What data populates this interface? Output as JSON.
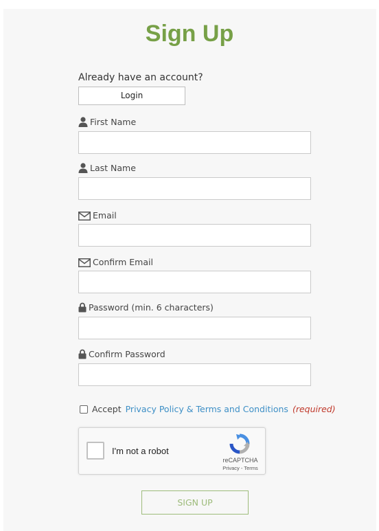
{
  "page": {
    "title": "Sign Up",
    "already_text": "Already have an account?",
    "login_label": "Login"
  },
  "fields": [
    {
      "label": "First Name",
      "icon": "user-icon",
      "value": ""
    },
    {
      "label": "Last Name",
      "icon": "user-icon",
      "value": ""
    },
    {
      "label": "Email",
      "icon": "envelope-icon",
      "value": ""
    },
    {
      "label": "Confirm Email",
      "icon": "envelope-icon",
      "value": ""
    },
    {
      "label": "Password (min. 6 characters)",
      "icon": "lock-icon",
      "value": ""
    },
    {
      "label": "Confirm Password",
      "icon": "lock-icon",
      "value": ""
    }
  ],
  "accept": {
    "prefix": "Accept",
    "link_text": "Privacy Policy & Terms and Conditions",
    "required_text": "(required)",
    "checked": false
  },
  "recaptcha": {
    "label": "I'm not a robot",
    "brand": "reCAPTCHA",
    "privacy": "Privacy",
    "separator": " - ",
    "terms": "Terms"
  },
  "submit_label": "SIGN UP",
  "colors": {
    "title": "#77a047",
    "link": "#3d8fc6",
    "required": "#c0392b",
    "submit": "#9dbb7a"
  }
}
